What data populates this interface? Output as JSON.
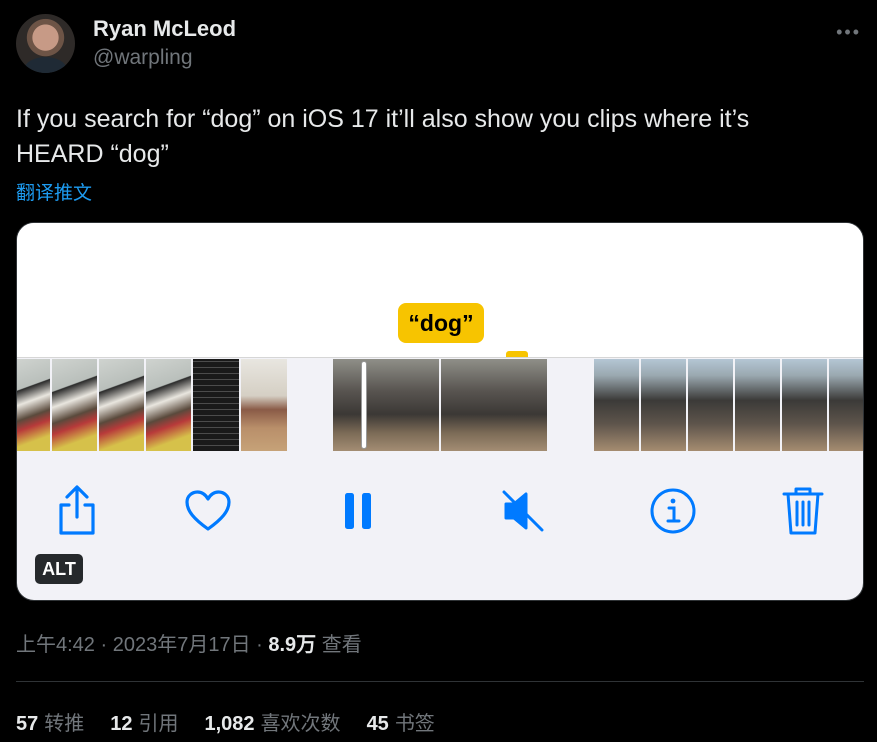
{
  "author": {
    "name": "Ryan McLeod",
    "handle": "@warpling"
  },
  "more_icon": "more-horizontal-icon",
  "tweet": {
    "text_line1": "If you search for “dog” on iOS 17 it’ll also show you clips where it’s",
    "text_line2": "HEARD “dog”",
    "translate_label": "翻译推文"
  },
  "media": {
    "search_term": "“dog”",
    "alt_badge": "ALT",
    "toolbar_icons": [
      "share-icon",
      "heart-icon",
      "pause-icon",
      "mute-icon",
      "info-icon",
      "trash-icon"
    ],
    "accent_color": "#007aff",
    "highlight_color": "#f7c400"
  },
  "meta": {
    "time": "上午4:42",
    "sep1": " · ",
    "date": "2023年7月17日",
    "sep2": " · ",
    "views_count": "8.9万",
    "views_label": " 查看"
  },
  "stats": [
    {
      "num": "57",
      "label": "转推"
    },
    {
      "num": "12",
      "label": "引用"
    },
    {
      "num": "1,082",
      "label": "喜欢次数"
    },
    {
      "num": "45",
      "label": "书签"
    }
  ]
}
